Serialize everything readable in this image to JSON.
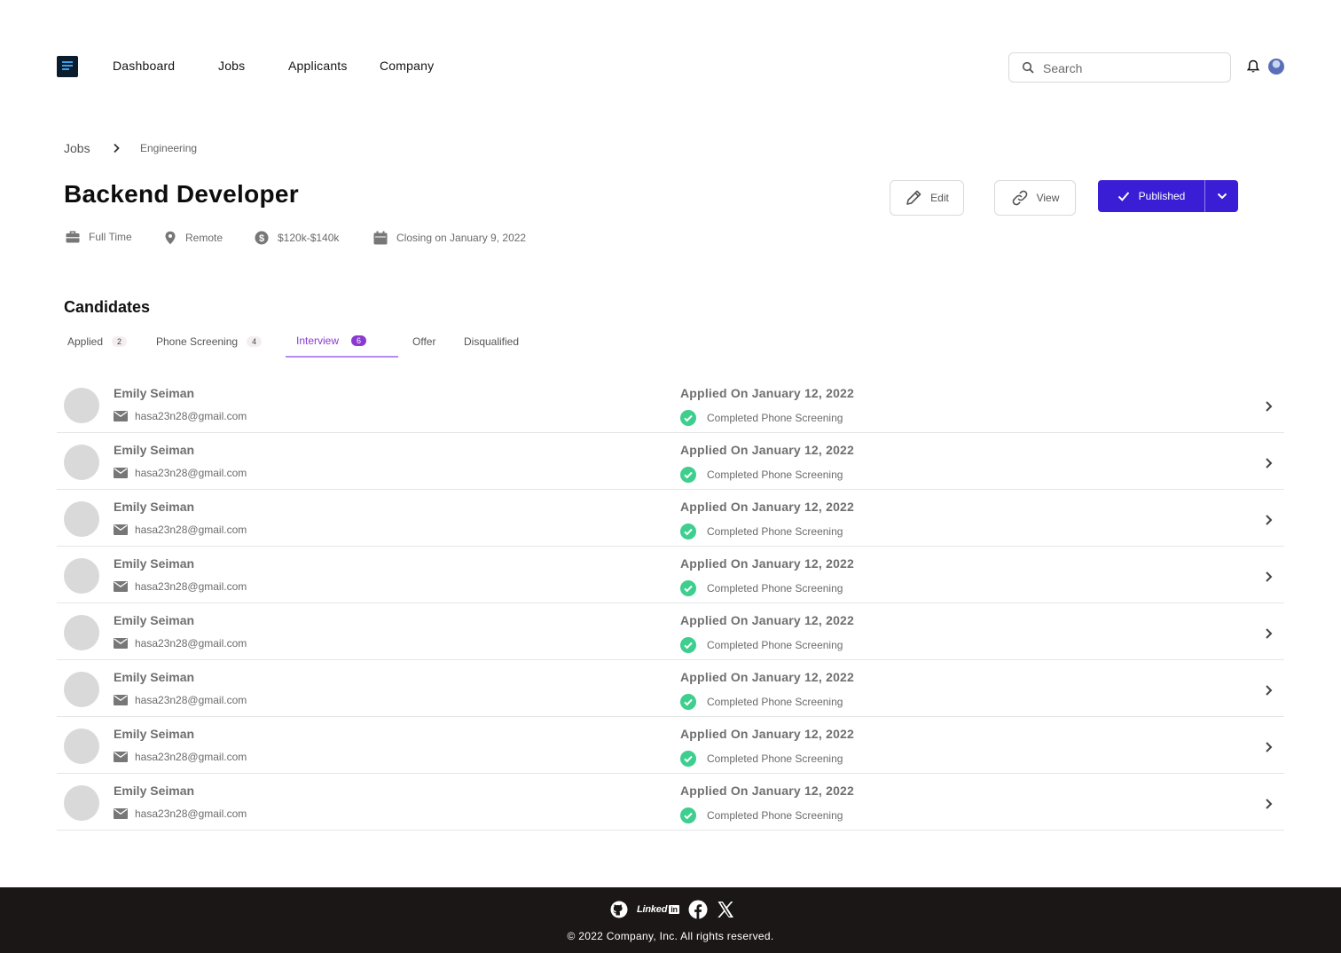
{
  "nav": {
    "links": [
      "Dashboard",
      "Jobs",
      "Applicants",
      "Company"
    ],
    "search_placeholder": "Search"
  },
  "breadcrumb": {
    "root": "Jobs",
    "leaf": "Engineering"
  },
  "job": {
    "title": "Backend Developer",
    "type": "Full Time",
    "location": "Remote",
    "salary": "$120k-$140k",
    "closing": "Closing on January 9, 2022"
  },
  "actions": {
    "edit": "Edit",
    "view": "View",
    "published": "Published"
  },
  "candidates": {
    "title": "Candidates",
    "tabs": [
      {
        "label": "Applied",
        "count": "2"
      },
      {
        "label": "Phone Screening",
        "count": "4"
      },
      {
        "label": "Interview",
        "count": "6"
      },
      {
        "label": "Offer"
      },
      {
        "label": "Disqualified"
      }
    ],
    "active_tab": "Interview",
    "rows": [
      {
        "name": "Emily Seiman",
        "email": "hasa23n28@gmail.com",
        "applied": "Applied On January 12, 2022",
        "status": "Completed Phone Screening"
      },
      {
        "name": "Emily Seiman",
        "email": "hasa23n28@gmail.com",
        "applied": "Applied On January 12, 2022",
        "status": "Completed Phone Screening"
      },
      {
        "name": "Emily Seiman",
        "email": "hasa23n28@gmail.com",
        "applied": "Applied On January 12, 2022",
        "status": "Completed Phone Screening"
      },
      {
        "name": "Emily Seiman",
        "email": "hasa23n28@gmail.com",
        "applied": "Applied On January 12, 2022",
        "status": "Completed Phone Screening"
      },
      {
        "name": "Emily Seiman",
        "email": "hasa23n28@gmail.com",
        "applied": "Applied On January 12, 2022",
        "status": "Completed Phone Screening"
      },
      {
        "name": "Emily Seiman",
        "email": "hasa23n28@gmail.com",
        "applied": "Applied On January 12, 2022",
        "status": "Completed Phone Screening"
      },
      {
        "name": "Emily Seiman",
        "email": "hasa23n28@gmail.com",
        "applied": "Applied On January 12, 2022",
        "status": "Completed Phone Screening"
      },
      {
        "name": "Emily Seiman",
        "email": "hasa23n28@gmail.com",
        "applied": "Applied On January 12, 2022",
        "status": "Completed Phone Screening"
      }
    ]
  },
  "footer": {
    "linkedin_label": "Linked",
    "linkedin_badge": "in",
    "copyright": "© 2022 Company, Inc. All rights reserved."
  },
  "colors": {
    "primary": "#3a1ed6",
    "tab_active": "#8a3ad0",
    "success": "#3ecf8e",
    "footer_bg": "#1b1717"
  },
  "icons": [
    "logo",
    "search-icon",
    "bell-icon",
    "chevron-right-icon",
    "briefcase-icon",
    "location-pin-icon",
    "dollar-icon",
    "calendar-icon",
    "pencil-icon",
    "link-icon",
    "check-icon",
    "chevron-down-icon",
    "mail-icon",
    "check-circle-icon",
    "github-icon",
    "facebook-icon",
    "x-icon"
  ]
}
